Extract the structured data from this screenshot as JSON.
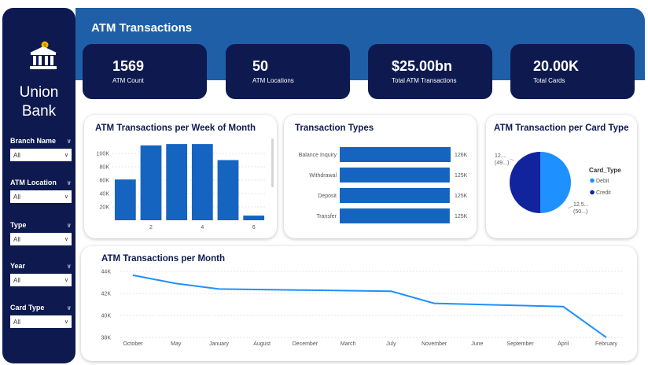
{
  "sidebar": {
    "brand_line1": "Union",
    "brand_line2": "Bank",
    "filters": [
      {
        "label": "Branch Name",
        "value": "All"
      },
      {
        "label": "ATM Location",
        "value": "All"
      },
      {
        "label": "Type",
        "value": "All"
      },
      {
        "label": "Year",
        "value": "All"
      },
      {
        "label": "Card Type",
        "value": "All"
      }
    ]
  },
  "header": {
    "title": "ATM Transactions"
  },
  "kpis": [
    {
      "value": "1569",
      "label": "ATM Count"
    },
    {
      "value": "50",
      "label": "ATM Locations"
    },
    {
      "value": "$25.00bn",
      "label": "Total ATM Transactions"
    },
    {
      "value": "20.00K",
      "label": "Total Cards"
    }
  ],
  "colors": {
    "navy": "#0e1a4f",
    "header_blue": "#1e5fa8",
    "bar_blue": "#1565c0",
    "debit": "#1e90ff",
    "credit": "#12239e",
    "line": "#1e90ff"
  },
  "chart_data": [
    {
      "type": "bar",
      "title": "ATM Transactions per Week of Month",
      "x": [
        1,
        2,
        3,
        4,
        5,
        6
      ],
      "values": [
        61000,
        112000,
        114000,
        114000,
        90000,
        7000
      ],
      "xticks": [
        "2",
        "4",
        "6"
      ],
      "yticks": [
        "20K",
        "40K",
        "60K",
        "80K",
        "100K"
      ],
      "ylim": [
        0,
        120000
      ]
    },
    {
      "type": "bar",
      "orientation": "horizontal",
      "title": "Transaction Types",
      "categories": [
        "Balance Inquiry",
        "Withdrawal",
        "Deposit",
        "Transfer"
      ],
      "values": [
        126,
        125,
        125,
        125
      ],
      "value_labels": [
        "126K",
        "125K",
        "125K",
        "125K"
      ]
    },
    {
      "type": "pie",
      "title": "ATM Transaction per Card Type",
      "legend_title": "Card_Type",
      "legend_position": "right",
      "slices": [
        {
          "name": "Debit",
          "value": 50,
          "label_top": "12.5...",
          "label_bottom": "(50...)"
        },
        {
          "name": "Credit",
          "value": 50,
          "label_top": "12....",
          "label_bottom": "(49...)"
        }
      ]
    },
    {
      "type": "line",
      "title": "ATM Transactions per Month",
      "categories": [
        "October",
        "May",
        "January",
        "August",
        "December",
        "March",
        "July",
        "November",
        "June",
        "September",
        "April",
        "February"
      ],
      "values": [
        43650,
        42900,
        42400,
        42350,
        42300,
        42250,
        42200,
        41100,
        41000,
        40900,
        40800,
        38000
      ],
      "yticks": [
        "38K",
        "40K",
        "42K",
        "44K"
      ],
      "ylim": [
        38000,
        44000
      ]
    }
  ]
}
